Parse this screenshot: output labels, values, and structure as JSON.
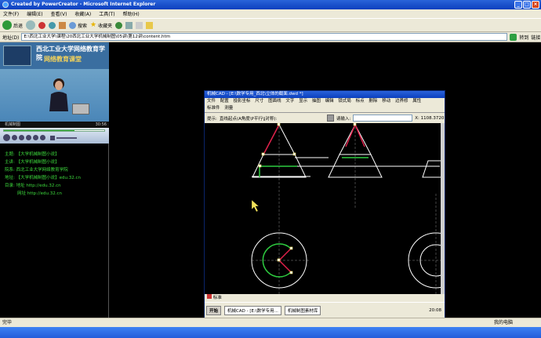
{
  "window": {
    "title": "Created by PowerCreator - Microsoft Internet Explorer"
  },
  "menu": {
    "items": [
      "文件(F)",
      "编辑(E)",
      "查看(V)",
      "收藏(A)",
      "工具(T)",
      "帮助(H)"
    ]
  },
  "toolbar": {
    "back": "后退",
    "search": "搜索",
    "favorites": "收藏夹"
  },
  "address": {
    "label": "地址(D)",
    "value": "E:\\西北工业大学\\课程\\20西北工业大学机械制图\\05讲\\第12讲\\content.htm",
    "go": "转到",
    "links": "链接"
  },
  "video": {
    "banner_line1": "西北工业大学网络教育学院",
    "banner_line2": "网络教育课堂",
    "caption": "机械制图",
    "time": "30:56"
  },
  "info": {
    "rows": [
      {
        "k": "主题:",
        "v": "【大学机械制图小说】"
      },
      {
        "k": "主讲:",
        "v": "【大学机械制图小说】"
      },
      {
        "k": "院系:",
        "v": "西北工业大学网络教育学院"
      },
      {
        "k": "地址:",
        "v": "【大学机械制图小说】edu.32.cn"
      },
      {
        "k": "目录:",
        "v": "地址  http://edu.32.cn"
      },
      {
        "k": "",
        "v": "网址  http://edu.32.cn"
      }
    ]
  },
  "cad": {
    "title": "机械CAD - [E:\\数学专用_西北\\立体的截面.dwd *]",
    "menu_row1": [
      "文件",
      "配置",
      "投影坐标",
      "尺寸",
      "图面线",
      "文字",
      "显示",
      "抽图",
      "编辑",
      "锁式局",
      "标点",
      "删除",
      "移动",
      "边界修",
      "属性"
    ],
    "menu_row2": [
      "标准件",
      "测量"
    ],
    "prompt_label": "提示:",
    "prompt": "直线起点(A角度\\P平行\\J对称):",
    "input_label": "请输入:",
    "coords": "X: 1108.3720",
    "status_tab": "标准",
    "task_start": "开始",
    "task_item1": "机械CAD - [E:\\数学专用...",
    "task_item2": "机械制图素材库",
    "task_time": "20:08"
  },
  "status": {
    "left": "完毕",
    "zone": "我的电脑"
  }
}
